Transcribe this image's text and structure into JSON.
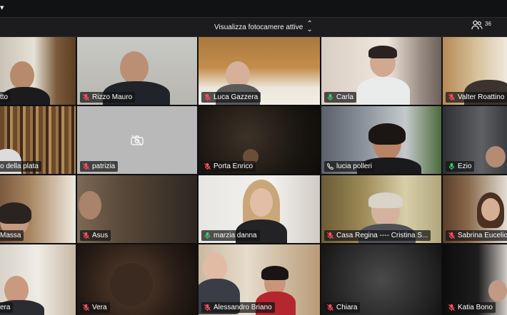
{
  "toolbar": {
    "view_label": "Visualizza fotocamere attive",
    "participants_count": "36"
  },
  "tiles": [
    {
      "name": "tto",
      "mic": "muted"
    },
    {
      "name": "Rizzo Mauro",
      "mic": "muted"
    },
    {
      "name": "Luca Gazzera",
      "mic": "muted"
    },
    {
      "name": "Carla",
      "mic": "active"
    },
    {
      "name": "Valter Roattino",
      "mic": "muted"
    },
    {
      "name": "o della plata",
      "mic": "none"
    },
    {
      "name": "patrizia",
      "mic": "muted",
      "camera": "off"
    },
    {
      "name": "Porta Enrico",
      "mic": "muted"
    },
    {
      "name": "lucia polleri",
      "mic": "phone"
    },
    {
      "name": "Ezio",
      "mic": "active"
    },
    {
      "name": "Massa",
      "mic": "none"
    },
    {
      "name": "Asus",
      "mic": "muted"
    },
    {
      "name": "marzia danna",
      "mic": "active"
    },
    {
      "name": "Casa Regina ---- Cristina S...",
      "mic": "muted"
    },
    {
      "name": "Sabrina Eucelio",
      "mic": "muted"
    },
    {
      "name": "era",
      "mic": "none"
    },
    {
      "name": "Vera",
      "mic": "muted"
    },
    {
      "name": "Alessandro Briano",
      "mic": "muted"
    },
    {
      "name": "Chiara",
      "mic": "muted"
    },
    {
      "name": "Katia Bono",
      "mic": "muted"
    }
  ],
  "colors": {
    "muted_mic": "#ff4d5e",
    "active_mic": "#3bd16f",
    "tile_label_bg": "#141414"
  }
}
